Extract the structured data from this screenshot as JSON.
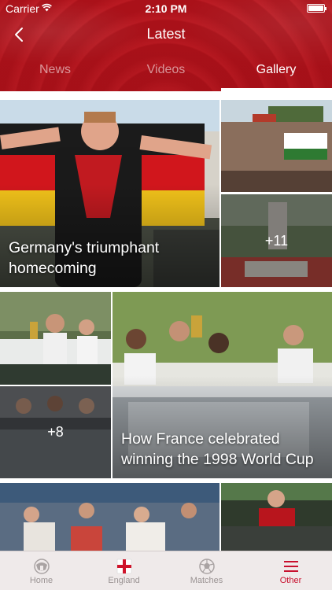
{
  "status_bar": {
    "carrier": "Carrier",
    "time": "2:10 PM"
  },
  "nav": {
    "title": "Latest",
    "back_icon": "chevron-left-icon"
  },
  "tabs": [
    {
      "label": "News",
      "active": false
    },
    {
      "label": "Videos",
      "active": false
    },
    {
      "label": "Gallery",
      "active": true
    }
  ],
  "gallery": {
    "story_1": {
      "caption": "Germany's triumphant homecoming",
      "more_count": "+11"
    },
    "story_2": {
      "caption": "How France celebrated winning the 1998 World Cup",
      "more_count": "+8"
    }
  },
  "tab_bar": [
    {
      "label": "Home",
      "icon": "football-home-icon",
      "active": false
    },
    {
      "label": "England",
      "icon": "england-flag-icon",
      "active": false
    },
    {
      "label": "Matches",
      "icon": "soccer-ball-icon",
      "active": false
    },
    {
      "label": "Other",
      "icon": "menu-icon",
      "active": true
    }
  ],
  "colors": {
    "brand_red": "#b8161e",
    "active_tab_bar": "#c8102e",
    "inactive_tab_bar": "#9a9393"
  }
}
